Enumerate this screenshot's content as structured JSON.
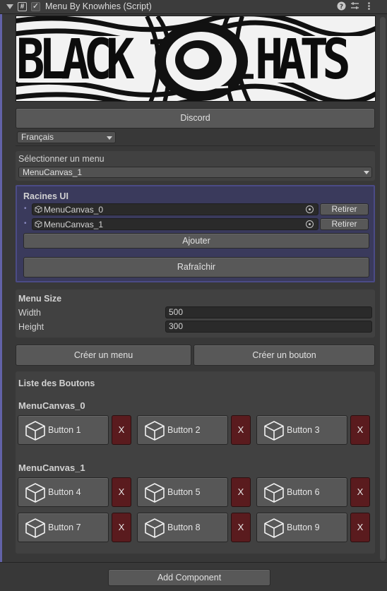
{
  "header": {
    "title": "Menu By Knowhies (Script)",
    "enabled": true,
    "icons": [
      "help-icon",
      "preset-icon",
      "more-icon"
    ]
  },
  "banner": {
    "left_text": "BLACK",
    "right_text": "HATS"
  },
  "discord_button": "Discord",
  "language": {
    "selected": "Français"
  },
  "menu_select": {
    "label": "Sélectionner un menu",
    "selected": "MenuCanvas_1"
  },
  "racines": {
    "title": "Racines UI",
    "items": [
      {
        "value": "MenuCanvas_0",
        "remove": "Retirer"
      },
      {
        "value": "MenuCanvas_1",
        "remove": "Retirer"
      }
    ],
    "add_button": "Ajouter",
    "refresh_button": "Rafraîchir"
  },
  "menu_size": {
    "title": "Menu Size",
    "width_label": "Width",
    "width_value": "500",
    "height_label": "Height",
    "height_value": "300"
  },
  "actions": {
    "create_menu": "Créer un menu",
    "create_button": "Créer un bouton"
  },
  "buttons_list": {
    "title": "Liste des Boutons",
    "groups": [
      {
        "name": "MenuCanvas_0",
        "buttons": [
          "Button 1",
          "Button 2",
          "Button 3"
        ]
      },
      {
        "name": "MenuCanvas_1",
        "buttons": [
          "Button 4",
          "Button 5",
          "Button 6",
          "Button 7",
          "Button 8",
          "Button 9"
        ]
      }
    ],
    "delete_label": "X"
  },
  "footer": {
    "add_component": "Add Component"
  },
  "colors": {
    "accent": "#6262a8",
    "racines_bg": "#3a3a5c",
    "delete_red": "#5a1b1e"
  }
}
